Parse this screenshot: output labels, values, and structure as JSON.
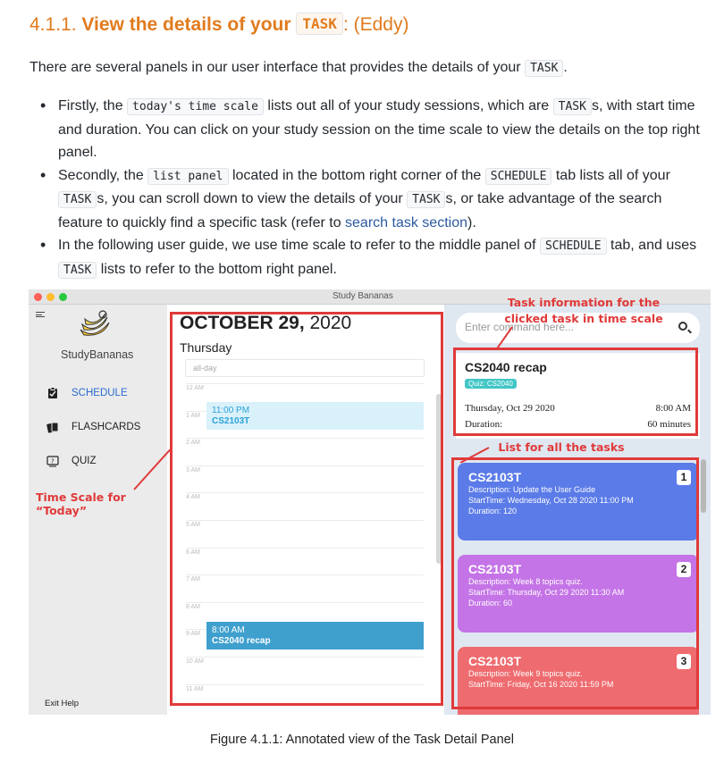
{
  "heading": {
    "number": "4.1.1.",
    "title": "View the details of your",
    "tag": "TASK",
    "author": ": (Eddy)"
  },
  "intro": {
    "before": "There are several panels in our user interface that provides the details of your",
    "code": "TASK",
    "after": "."
  },
  "bullets": [
    {
      "parts": [
        {
          "t": "Firstly, the "
        },
        {
          "c": "today's time scale"
        },
        {
          "t": " lists out all of your study sessions, which are "
        },
        {
          "c": "TASK"
        },
        {
          "t": "s, with start time and duration. You can click on your study session on the time scale to view the details on the top right panel."
        }
      ]
    },
    {
      "parts": [
        {
          "t": "Secondly, the "
        },
        {
          "c": "list panel"
        },
        {
          "t": " located in the bottom right corner of the "
        },
        {
          "c": "SCHEDULE"
        },
        {
          "t": " tab lists all of your "
        },
        {
          "c": "TASK"
        },
        {
          "t": "s, you can scroll down to view the details of your "
        },
        {
          "c": "TASK"
        },
        {
          "t": "s, or take advantage of the search feature to quickly find a specific task (refer to "
        },
        {
          "a": "search task section"
        },
        {
          "t": ")."
        }
      ]
    },
    {
      "parts": [
        {
          "t": "In the following user guide, we use time scale to refer to the middle panel of "
        },
        {
          "c": "SCHEDULE"
        },
        {
          "t": " tab, and uses "
        },
        {
          "c": "TASK"
        },
        {
          "t": " lists to refer to the bottom right panel."
        }
      ]
    }
  ],
  "app": {
    "window_title": "Study Bananas",
    "brand": "StudyBananas",
    "nav": [
      {
        "label": "SCHEDULE",
        "icon": "clipboard-icon",
        "active": true
      },
      {
        "label": "FLASHCARDS",
        "icon": "cards-icon",
        "active": false
      },
      {
        "label": "QUIZ",
        "icon": "quiz-icon",
        "active": false
      }
    ],
    "footer": "Exit  Help",
    "calendar": {
      "month": "OCTOBER 29,",
      "year": " 2020",
      "weekday": "Thursday",
      "allday": "all-day",
      "hours": [
        "12 AM",
        "1 AM",
        "2 AM",
        "3 AM",
        "4 AM",
        "5 AM",
        "6 AM",
        "7 AM",
        "8 AM",
        "9 AM",
        "10 AM",
        "11 AM"
      ],
      "events": [
        {
          "time": "11:00 PM",
          "name": "CS2103T"
        },
        {
          "time": "8:00 AM",
          "name": "CS2040 recap"
        }
      ]
    },
    "search_placeholder": "Enter command here...",
    "detail": {
      "title": "CS2040 recap",
      "tag": "Quiz: CS2040",
      "date": "Thursday, Oct 29 2020",
      "time": "8:00 AM",
      "duration_label": "Duration:",
      "duration": "60 minutes"
    },
    "tasks": [
      {
        "title": "CS2103T",
        "index": "1",
        "description": "Description:   Update the User Guide",
        "start": "StartTime:  Wednesday, Oct 28 2020   11:00 PM",
        "duration": "Duration:  120"
      },
      {
        "title": "CS2103T",
        "index": "2",
        "description": "Description:    Week 8 topics quiz.",
        "start": "StartTime:  Thursday, Oct 29 2020    11:30 AM",
        "duration": "Duration:  60"
      },
      {
        "title": "CS2103T",
        "index": "3",
        "description": "Description:    Week 9 topics quiz.",
        "start": "StartTime:  Friday, Oct 16 2020   11:59 PM",
        "duration": ""
      }
    ]
  },
  "annotations": {
    "task_info": "Task information for the clicked task in time scale",
    "list": "List for all the tasks",
    "time_scale": "Time Scale for “Today”",
    "color": "#e03a3a"
  },
  "caption": "Figure 4.1.1: Annotated view of the Task Detail Panel"
}
